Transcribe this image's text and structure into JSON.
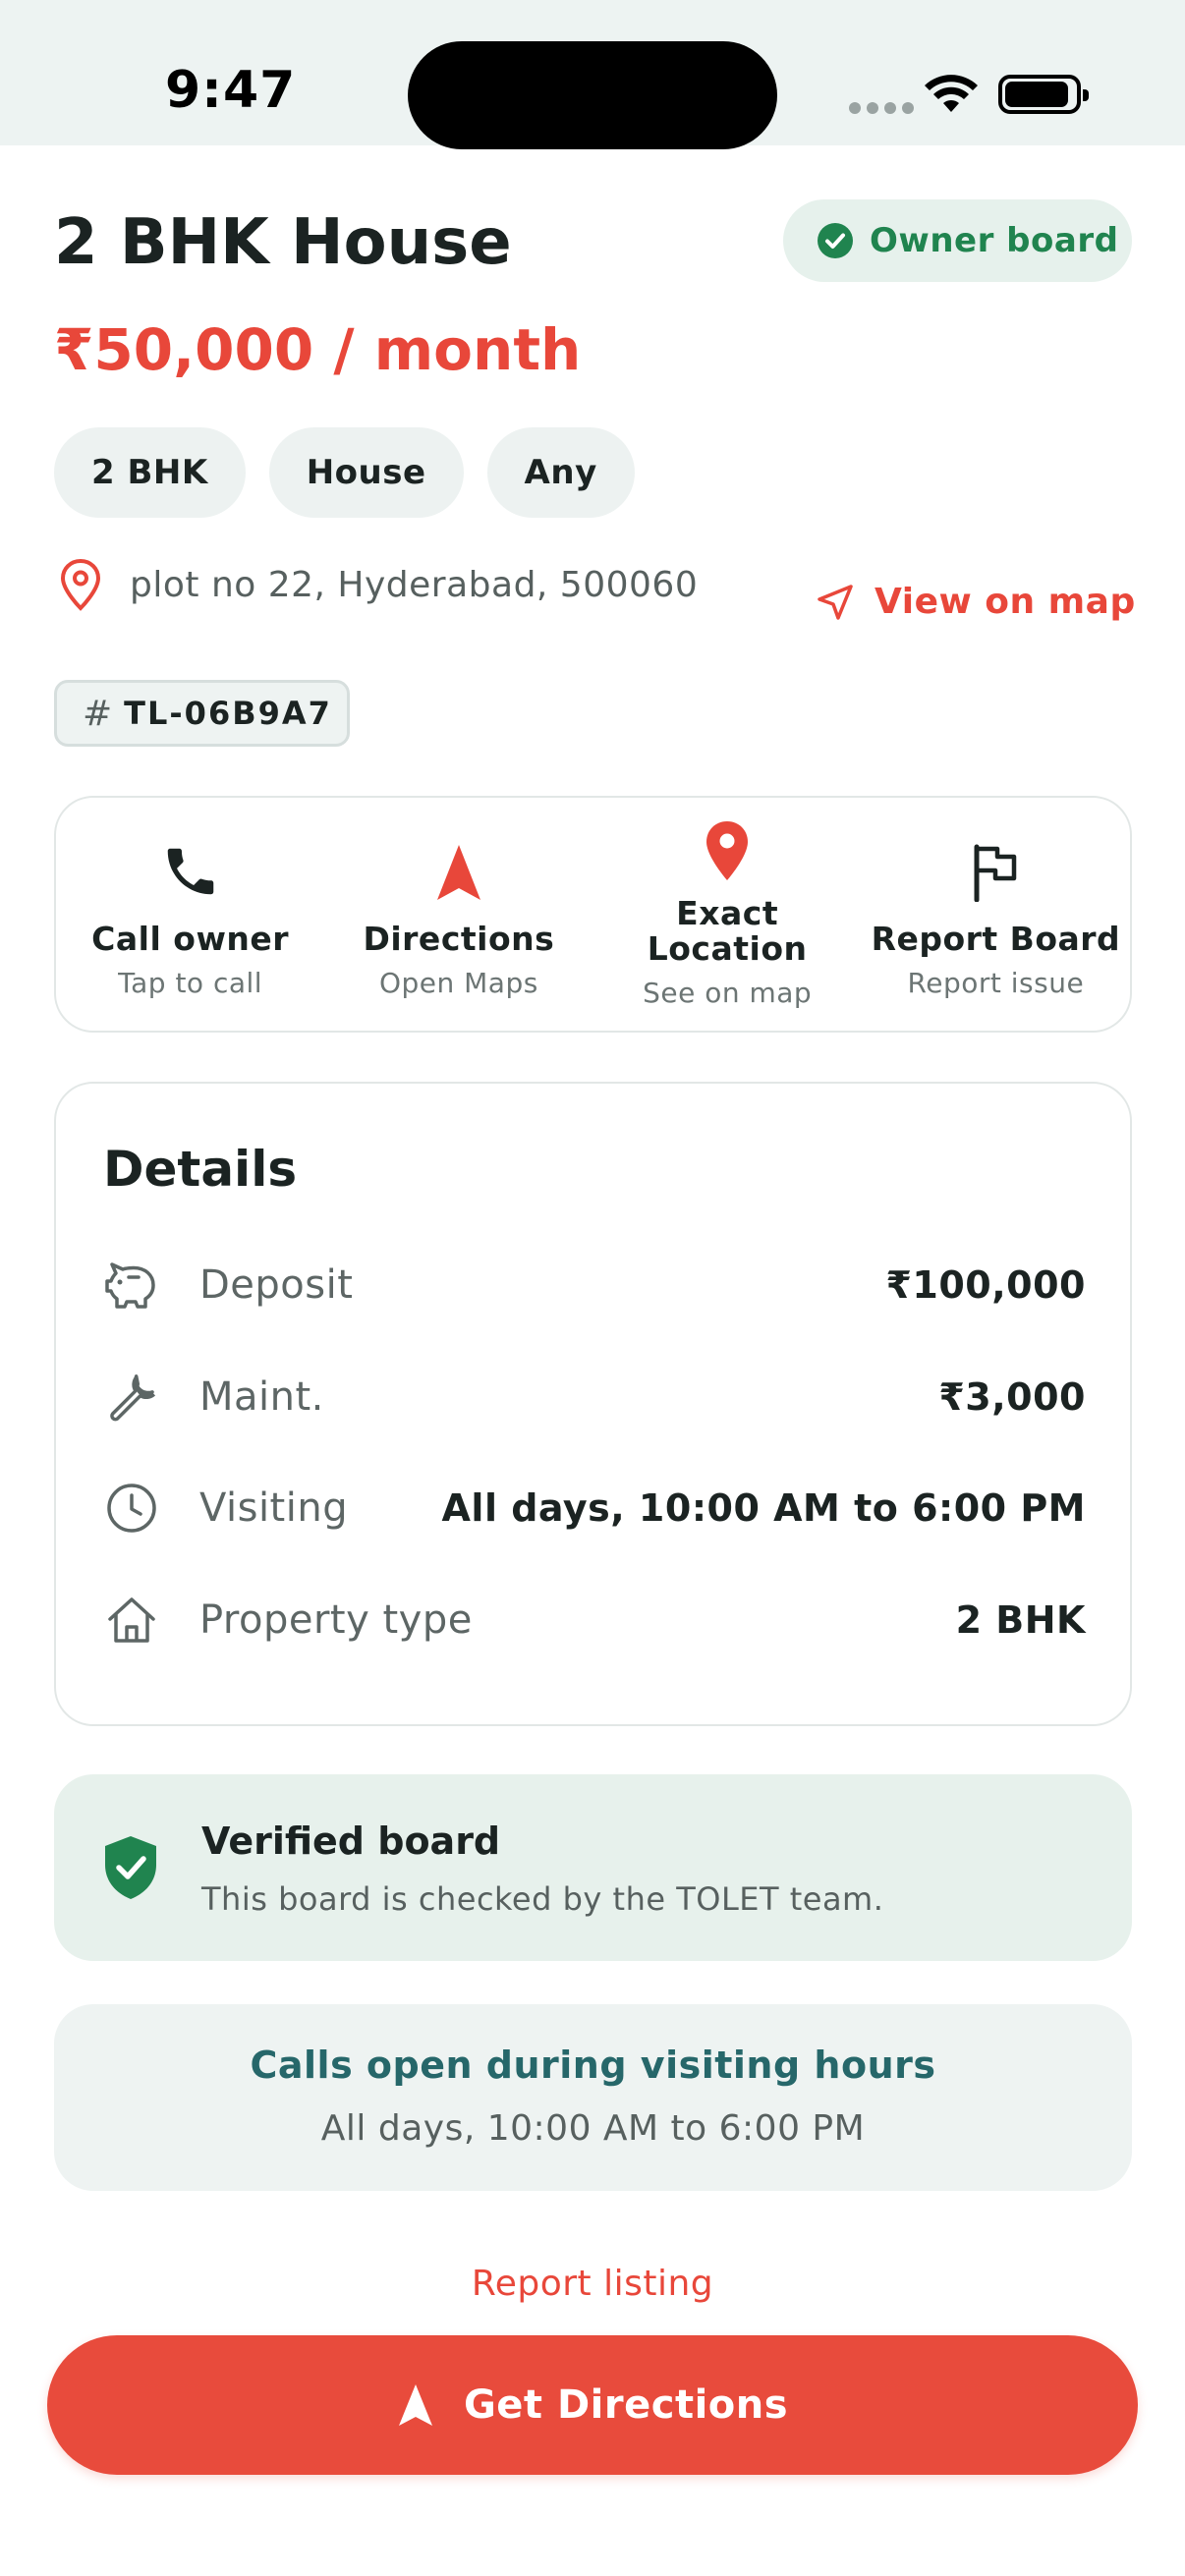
{
  "status_bar": {
    "time": "9:47"
  },
  "listing": {
    "title": "2 BHK House",
    "owner_badge": "Owner board",
    "price": "₹50,000 / month",
    "chips": [
      "2 BHK",
      "House",
      "Any"
    ],
    "address": "plot no 22, Hyderabad, 500060",
    "view_on_map": "View on map",
    "code": "TL-06B9A7"
  },
  "actions": [
    {
      "label": "Call owner",
      "sub": "Tap to call",
      "icon": "phone-icon"
    },
    {
      "label": "Directions",
      "sub": "Open Maps",
      "icon": "navigation-arrow-icon"
    },
    {
      "label": "Exact Location",
      "sub": "See on map",
      "icon": "map-pin-icon"
    },
    {
      "label": "Report Board",
      "sub": "Report issue",
      "icon": "flag-icon"
    }
  ],
  "details": {
    "title": "Details",
    "rows": [
      {
        "label": "Deposit",
        "value": "₹100,000",
        "icon": "piggy-bank-icon"
      },
      {
        "label": "Maint.",
        "value": "₹3,000",
        "icon": "wrench-icon"
      },
      {
        "label": "Visiting",
        "value": "All days, 10:00 AM to 6:00 PM",
        "icon": "clock-icon"
      },
      {
        "label": "Property type",
        "value": "2 BHK",
        "icon": "home-icon"
      }
    ]
  },
  "verified": {
    "title": "Verified board",
    "subtitle": "This board is checked by the TOLET team.",
    "icon": "shield-check-icon"
  },
  "calls_notice": {
    "title": "Calls open during visiting hours",
    "subtitle": "All days, 10:00 AM to 6:00 PM"
  },
  "report_link": "Report listing",
  "cta": {
    "label": "Get Directions",
    "icon": "navigation-arrow-icon"
  },
  "colors": {
    "accent": "#e8473a",
    "success": "#20844f",
    "teal": "#26676a",
    "text": "#1b2322"
  }
}
